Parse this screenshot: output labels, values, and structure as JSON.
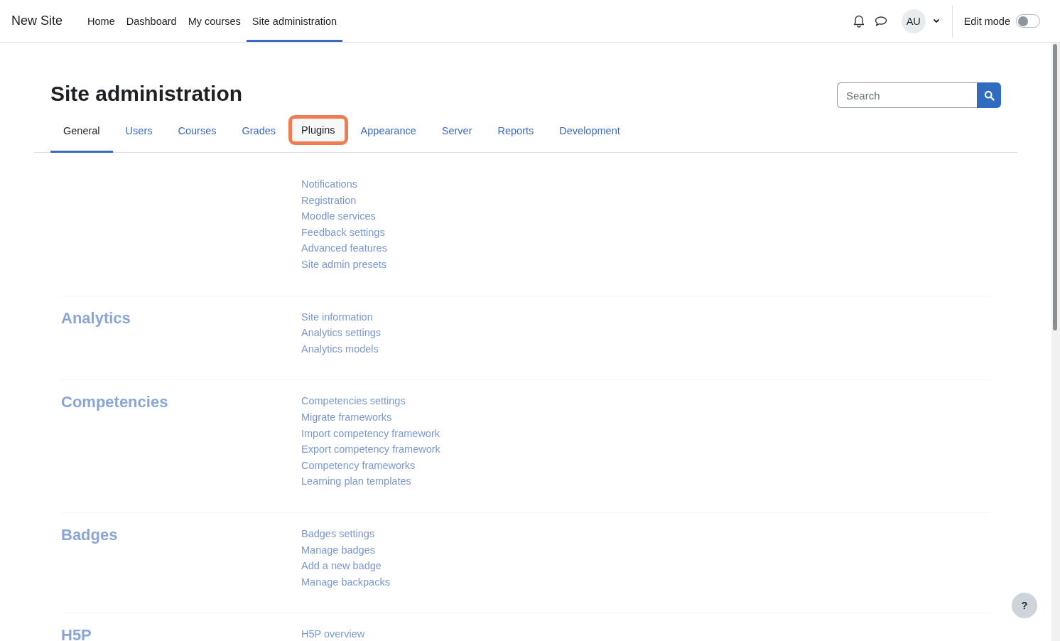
{
  "navbar": {
    "site_name": "New Site",
    "links": [
      {
        "label": "Home",
        "selected": false
      },
      {
        "label": "Dashboard",
        "selected": false
      },
      {
        "label": "My courses",
        "selected": false
      },
      {
        "label": "Site administration",
        "selected": true
      }
    ],
    "avatar": "AU",
    "edit_mode": {
      "label": "Edit mode",
      "on": false
    }
  },
  "page": {
    "title": "Site administration",
    "search": {
      "placeholder": "Search"
    }
  },
  "tabs": [
    {
      "label": "General",
      "selected": true,
      "highlighted": false
    },
    {
      "label": "Users",
      "selected": false,
      "highlighted": false
    },
    {
      "label": "Courses",
      "selected": false,
      "highlighted": false
    },
    {
      "label": "Grades",
      "selected": false,
      "highlighted": false
    },
    {
      "label": "Plugins",
      "selected": false,
      "highlighted": true
    },
    {
      "label": "Appearance",
      "selected": false,
      "highlighted": false
    },
    {
      "label": "Server",
      "selected": false,
      "highlighted": false
    },
    {
      "label": "Reports",
      "selected": false,
      "highlighted": false
    },
    {
      "label": "Development",
      "selected": false,
      "highlighted": false
    }
  ],
  "sections": [
    {
      "links": [
        "Notifications",
        "Registration",
        "Moodle services",
        "Feedback settings",
        "Advanced features",
        "Site admin presets"
      ]
    },
    {
      "heading": "Analytics",
      "links": [
        "Site information",
        "Analytics settings",
        "Analytics models"
      ]
    },
    {
      "heading": "Competencies",
      "links": [
        "Competencies settings",
        "Migrate frameworks",
        "Import competency framework",
        "Export competency framework",
        "Competency frameworks",
        "Learning plan templates"
      ]
    },
    {
      "heading": "Badges",
      "links": [
        "Badges settings",
        "Manage badges",
        "Add a new badge",
        "Manage backpacks"
      ]
    },
    {
      "heading": "H5P",
      "links": [
        "H5P overview"
      ]
    }
  ],
  "help_button": "?"
}
